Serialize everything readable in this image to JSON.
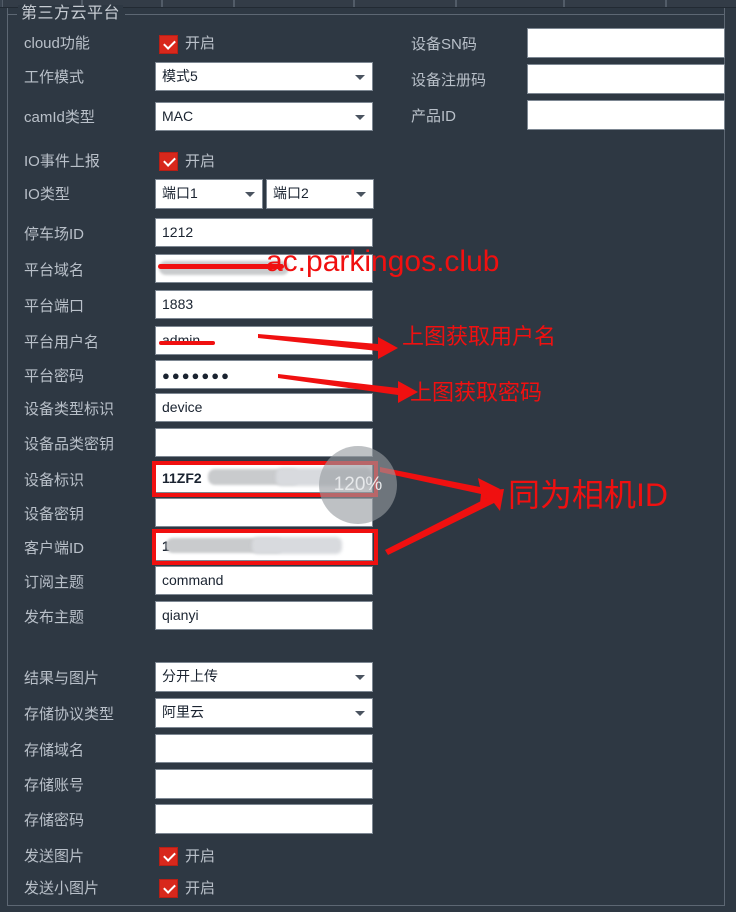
{
  "window": {
    "background_color": "#2e3843",
    "accent_color": "#d8281c",
    "annotation_color": "#f01010",
    "group_title": "第三方云平台"
  },
  "left_column": {
    "rows": [
      {
        "label": "cloud功能",
        "type": "checkbox",
        "checked": true,
        "check_label": "开启"
      },
      {
        "label": "工作模式",
        "type": "combo",
        "value": "模式5"
      },
      {
        "label": "camId类型",
        "type": "combo",
        "value": "MAC"
      },
      {
        "label": "IO事件上报",
        "type": "checkbox",
        "checked": true,
        "check_label": "开启"
      },
      {
        "label": "IO类型",
        "type": "combo2",
        "value": "端口1",
        "value2": "端口2"
      },
      {
        "label": "停车场ID",
        "type": "text",
        "value": "1212"
      },
      {
        "label": "平台域名",
        "type": "text",
        "value": "",
        "redacted": true,
        "struck": true
      },
      {
        "label": "平台端口",
        "type": "text",
        "value": "1883"
      },
      {
        "label": "平台用户名",
        "type": "text",
        "value": "admin",
        "struck": true
      },
      {
        "label": "平台密码",
        "type": "password",
        "value": "●●●●●●●"
      },
      {
        "label": "设备类型标识",
        "type": "text",
        "value": "device"
      },
      {
        "label": "设备品类密钥",
        "type": "text",
        "value": ""
      },
      {
        "label": "设备标识",
        "type": "text",
        "value": "11ZF2",
        "redacted": true,
        "highlighted": true
      },
      {
        "label": "设备密钥",
        "type": "text",
        "value": ""
      },
      {
        "label": "客户端ID",
        "type": "text",
        "value": "1",
        "redacted": true,
        "highlighted": true
      },
      {
        "label": "订阅主题",
        "type": "text",
        "value": "command"
      },
      {
        "label": "发布主题",
        "type": "text",
        "value": "qianyi"
      }
    ],
    "rows2": [
      {
        "label": "结果与图片",
        "type": "combo",
        "value": "分开上传"
      },
      {
        "label": "存储协议类型",
        "type": "combo",
        "value": "阿里云"
      },
      {
        "label": "存储域名",
        "type": "text",
        "value": ""
      },
      {
        "label": "存储账号",
        "type": "text",
        "value": ""
      },
      {
        "label": "存储密码",
        "type": "text",
        "value": ""
      },
      {
        "label": "发送图片",
        "type": "checkbox",
        "checked": true,
        "check_label": "开启"
      },
      {
        "label": "发送小图片",
        "type": "checkbox",
        "checked": true,
        "check_label": "开启"
      }
    ]
  },
  "right_column": {
    "rows": [
      {
        "label": "设备SN码",
        "type": "text",
        "value": ""
      },
      {
        "label": "设备注册码",
        "type": "text",
        "value": ""
      },
      {
        "label": "产品ID",
        "type": "text",
        "value": ""
      }
    ]
  },
  "annotations": {
    "domain_note": "ac.parkingos.club",
    "username_note": "上图获取用户名",
    "password_note": "上图获取密码",
    "camera_id_note": "同为相机ID"
  },
  "overlay": {
    "zoom_level": "120%"
  }
}
